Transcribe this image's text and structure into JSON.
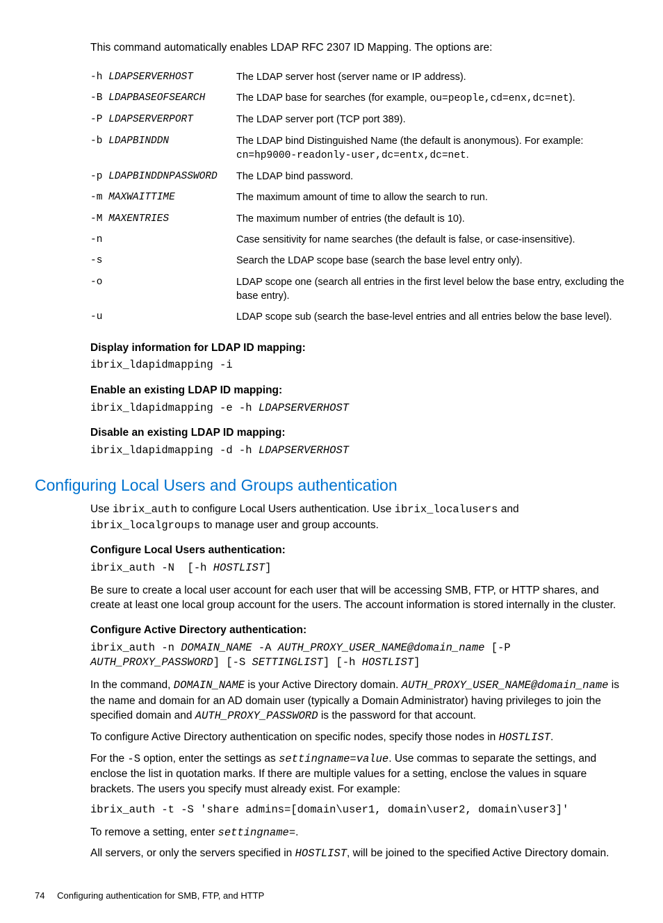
{
  "intro": "This command automatically enables LDAP RFC 2307 ID Mapping. The options are:",
  "opts": [
    {
      "flag": "-h",
      "arg": "LDAPSERVERHOST",
      "desc_pre": "The LDAP server host (server name or IP address).",
      "code": "",
      "desc_post": ""
    },
    {
      "flag": "-B",
      "arg": "LDAPBASEOFSEARCH",
      "desc_pre": "The LDAP base for searches (for example, ",
      "code": "ou=people,cd=enx,dc=net",
      "desc_post": ")."
    },
    {
      "flag": "-P",
      "arg": "LDAPSERVERPORT",
      "desc_pre": "The LDAP server port (TCP port 389).",
      "code": "",
      "desc_post": ""
    },
    {
      "flag": "-b",
      "arg": "LDAPBINDDN",
      "desc_pre": "The LDAP bind Distinguished Name (the default is anonymous). For example: ",
      "code": "cn=hp9000-readonly-user,dc=entx,dc=net",
      "desc_post": "."
    },
    {
      "flag": "-p",
      "arg": "LDAPBINDDNPASSWORD",
      "desc_pre": "The LDAP bind password.",
      "code": "",
      "desc_post": ""
    },
    {
      "flag": "-m",
      "arg": "MAXWAITTIME",
      "desc_pre": "The maximum amount of time to allow the search to run.",
      "code": "",
      "desc_post": ""
    },
    {
      "flag": "-M",
      "arg": "MAXENTRIES",
      "desc_pre": "The maximum number of entries (the default is 10).",
      "code": "",
      "desc_post": ""
    },
    {
      "flag": "-n",
      "arg": "",
      "desc_pre": "Case sensitivity for name searches (the default is false, or case-insensitive).",
      "code": "",
      "desc_post": ""
    },
    {
      "flag": "-s",
      "arg": "",
      "desc_pre": "Search the LDAP scope base (search the base level entry only).",
      "code": "",
      "desc_post": ""
    },
    {
      "flag": "-o",
      "arg": "",
      "desc_pre": "LDAP scope one (search all entries in the first level below the base entry, excluding the base entry).",
      "code": "",
      "desc_post": ""
    },
    {
      "flag": "-u",
      "arg": "",
      "desc_pre": "LDAP scope sub (search the base-level entries and all entries below the base level).",
      "code": "",
      "desc_post": ""
    }
  ],
  "sub1": "Display information for LDAP ID mapping:",
  "cmd1": "ibrix_ldapidmapping -i",
  "sub2": "Enable an existing LDAP ID mapping:",
  "cmd2_a": "ibrix_ldapidmapping -e -h ",
  "cmd2_b": "LDAPSERVERHOST",
  "sub3": "Disable an existing LDAP ID mapping:",
  "cmd3_a": "ibrix_ldapidmapping -d -h ",
  "cmd3_b": "LDAPSERVERHOST",
  "h2": "Configuring Local Users and Groups authentication",
  "p_use_1": "Use ",
  "p_use_c1": "ibrix_auth",
  "p_use_2": " to configure Local Users authentication. Use ",
  "p_use_c2": "ibrix_localusers",
  "p_use_3": " and ",
  "p_use_c3": "ibrix_localgroups",
  "p_use_4": " to manage user and group accounts.",
  "sub4": "Configure Local Users authentication:",
  "cmd4_a": "ibrix_auth -N  [-h ",
  "cmd4_b": "HOSTLIST",
  "cmd4_c": "]",
  "p_besure": "Be sure to create a local user account for each user that will be accessing SMB, FTP, or HTTP shares, and create at least one local group account for the users. The account information is stored internally in the cluster.",
  "sub5": "Configure Active Directory authentication:",
  "cmd5_a": "ibrix_auth -n ",
  "cmd5_b": "DOMAIN_NAME",
  "cmd5_c": " -A ",
  "cmd5_d": "AUTH_PROXY_USER_NAME@domain_name",
  "cmd5_e": " [-P ",
  "cmd5_f": "AUTH_PROXY_PASSWORD",
  "cmd5_g": "] [-S ",
  "cmd5_h": "SETTINGLIST",
  "cmd5_i": "] [-h ",
  "cmd5_j": "HOSTLIST",
  "cmd5_k": "]",
  "p_inc_1": "In the command, ",
  "p_inc_c1": "DOMAIN_NAME",
  "p_inc_2": " is your Active Directory domain. ",
  "p_inc_c2": "AUTH_PROXY_USER_NAME@domain_name",
  "p_inc_3": " is the name and domain for an AD domain user (typically a Domain Administrator) having privileges to join the specified domain and ",
  "p_inc_c3": "AUTH_PROXY_PASSWORD",
  "p_inc_4": " is the password for that account.",
  "p_spec_1": "To configure Active Directory authentication on specific nodes, specify those nodes in ",
  "p_spec_c1": "HOSTLIST",
  "p_spec_2": ".",
  "p_s_1": "For the ",
  "p_s_c1": "-S",
  "p_s_2": " option, enter the settings as ",
  "p_s_c2": "settingname=value",
  "p_s_3": ". Use commas to separate the settings, and enclose the list in quotation marks. If there are multiple values for a setting, enclose the values in square brackets. The users you specify must already exist. For example:",
  "cmd6": "ibrix_auth -t -S 'share admins=[domain\\user1, domain\\user2, domain\\user3]'",
  "p_rm_1": "To remove a setting, enter ",
  "p_rm_c1": "settingname=",
  "p_rm_2": ".",
  "p_all_1": "All servers, or only the servers specified in ",
  "p_all_c1": "HOSTLIST",
  "p_all_2": ", will be joined to the specified Active Directory domain.",
  "footer_page": "74",
  "footer_title": "Configuring authentication for SMB, FTP, and HTTP"
}
